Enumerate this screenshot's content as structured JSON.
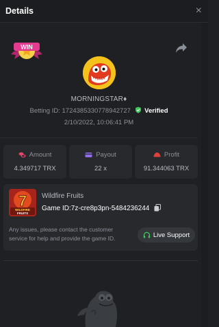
{
  "header": {
    "title": "Details",
    "close_label": "×"
  },
  "player": {
    "username": "MORNINGSTAR♦",
    "bet_label": "Betting ID:",
    "bet_id": "1724385330778942727",
    "verified": "Verified",
    "date": "2/10/2022, 10:06:41 PM"
  },
  "stats": [
    {
      "label": "Amount",
      "value": "4.349717 TRX",
      "icon": "coins-icon",
      "color": "#e8456b"
    },
    {
      "label": "Payout",
      "value": "22 x",
      "icon": "card-icon",
      "color": "#8f6cf0"
    },
    {
      "label": "Profit",
      "value": "91.344063 TRX",
      "icon": "money-icon",
      "color": "#e0403c"
    }
  ],
  "game": {
    "name": "Wildfire Fruits",
    "id_label": "Game ID:",
    "id_value": "7z-cre8p3pn-5484236244",
    "notice": "Any issues, please contact the customer service for help and provide the game ID.",
    "support_label": "Live Support",
    "thumb_title": "WILDFIRE",
    "thumb_sub": "FRUITS"
  },
  "badge": {
    "text": "WIN"
  },
  "colors": {
    "verified": "#3fc65a",
    "badge": "#e33b8f",
    "avatar": "#f3c21c"
  }
}
